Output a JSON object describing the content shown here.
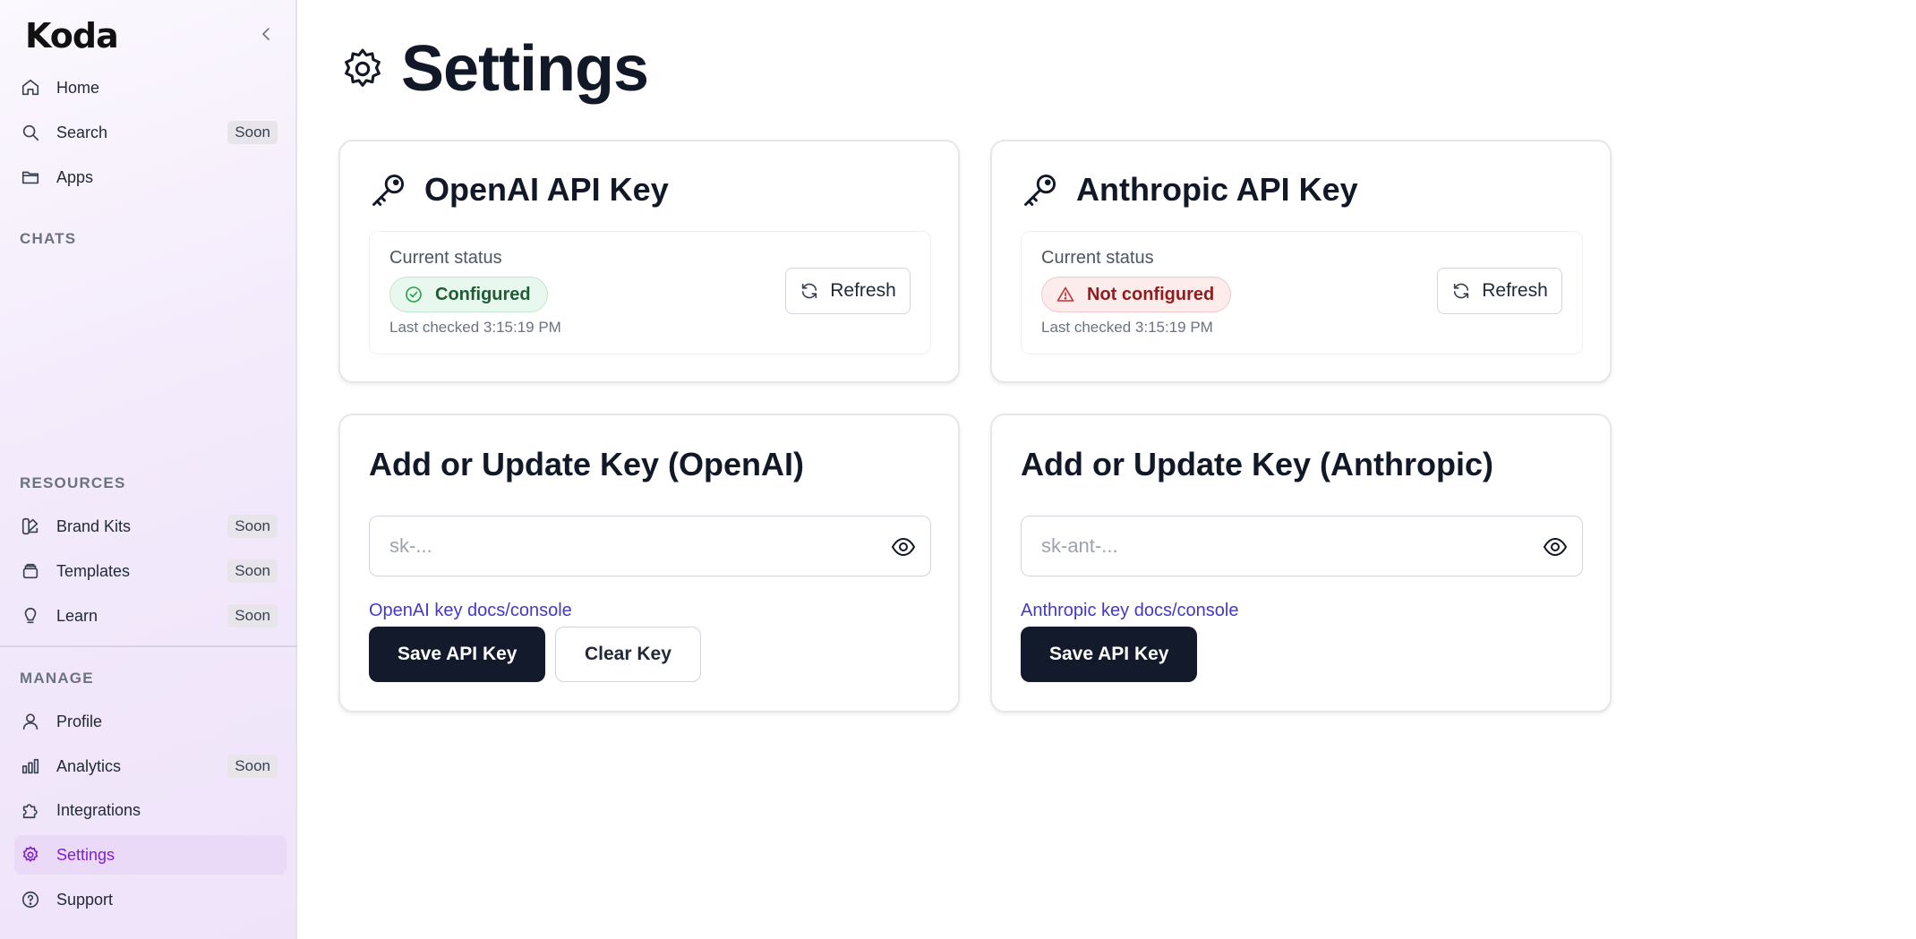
{
  "sidebar": {
    "logo": "Koda",
    "soon": "Soon",
    "nav": [
      {
        "label": "Home"
      },
      {
        "label": "Search",
        "badge": "Soon"
      },
      {
        "label": "Apps"
      }
    ],
    "chats_label": "CHATS",
    "resources_label": "RESOURCES",
    "resources": [
      {
        "label": "Brand Kits",
        "badge": "Soon"
      },
      {
        "label": "Templates",
        "badge": "Soon"
      },
      {
        "label": "Learn",
        "badge": "Soon"
      }
    ],
    "manage_label": "MANAGE",
    "manage": [
      {
        "label": "Profile"
      },
      {
        "label": "Analytics",
        "badge": "Soon"
      },
      {
        "label": "Integrations"
      },
      {
        "label": "Settings",
        "active": true
      },
      {
        "label": "Support"
      }
    ]
  },
  "page": {
    "title": "Settings"
  },
  "openai": {
    "title": "OpenAI API Key",
    "status_label": "Current status",
    "status": "Configured",
    "last_checked": "Last checked 3:15:19 PM",
    "refresh": "Refresh",
    "update_title": "Add or Update Key (OpenAI)",
    "placeholder": "sk-...",
    "docs_link": "OpenAI key docs/console",
    "save": "Save API Key",
    "clear": "Clear Key"
  },
  "anthropic": {
    "title": "Anthropic API Key",
    "status_label": "Current status",
    "status": "Not configured",
    "last_checked": "Last checked 3:15:19 PM",
    "refresh": "Refresh",
    "update_title": "Add or Update Key (Anthropic)",
    "placeholder": "sk-ant-...",
    "docs_link": "Anthropic key docs/console",
    "save": "Save API Key"
  },
  "colors": {
    "accent": "#7e22ce",
    "active_bg": "#ead9f7",
    "primary_button": "#131a2b",
    "link": "#4338ca",
    "ok": "#1f5c35",
    "error": "#8f1d1d"
  }
}
